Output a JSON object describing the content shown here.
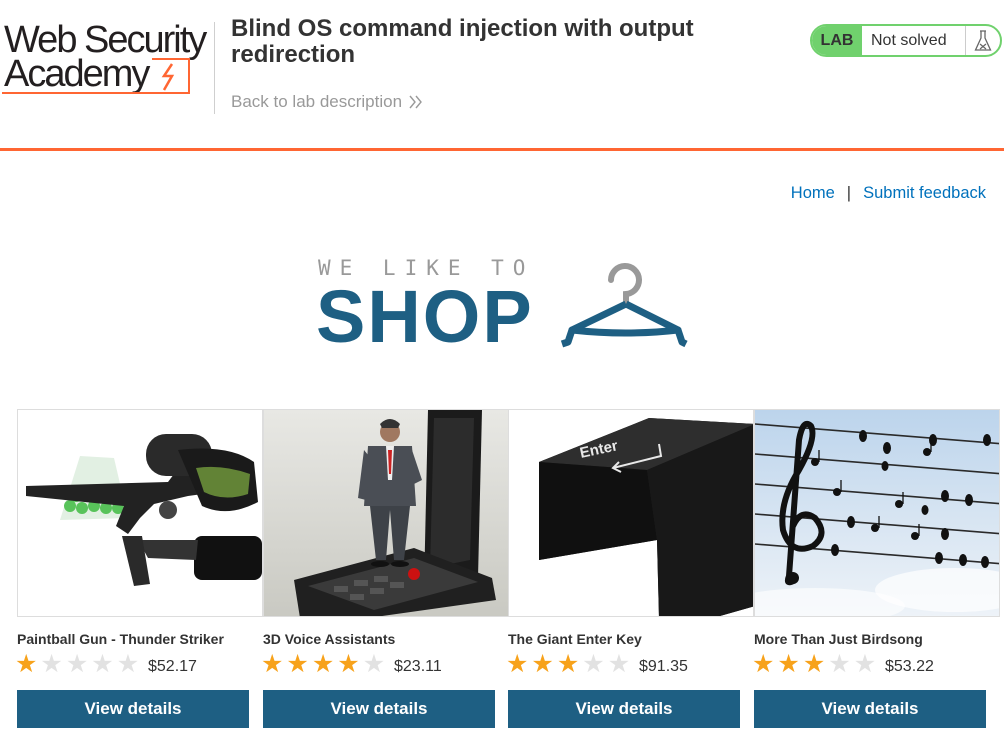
{
  "header": {
    "logo_line1": "Web Security",
    "logo_line2": "Academy",
    "lab_title": "Blind OS command injection with output redirection",
    "back_link": "Back to lab description",
    "status_badge": "LAB",
    "status_text": "Not solved",
    "accent_color": "#ff6633",
    "solved_color": "#70d16d"
  },
  "nav": {
    "home": "Home",
    "separator": "|",
    "feedback": "Submit feedback"
  },
  "banner": {
    "small": "WE LIKE TO",
    "big": "SHOP",
    "brand_color": "#1e5f83"
  },
  "products": [
    {
      "name": "Paintball Gun - Thunder Striker",
      "rating": 1,
      "price": "$52.17",
      "button": "View details"
    },
    {
      "name": "3D Voice Assistants",
      "rating": 4,
      "price": "$23.11",
      "button": "View details"
    },
    {
      "name": "The Giant Enter Key",
      "rating": 3,
      "price": "$91.35",
      "button": "View details"
    },
    {
      "name": "More Than Just Birdsong",
      "rating": 3,
      "price": "$53.22",
      "button": "View details"
    }
  ],
  "images": {
    "enter_key_label": "Enter"
  }
}
